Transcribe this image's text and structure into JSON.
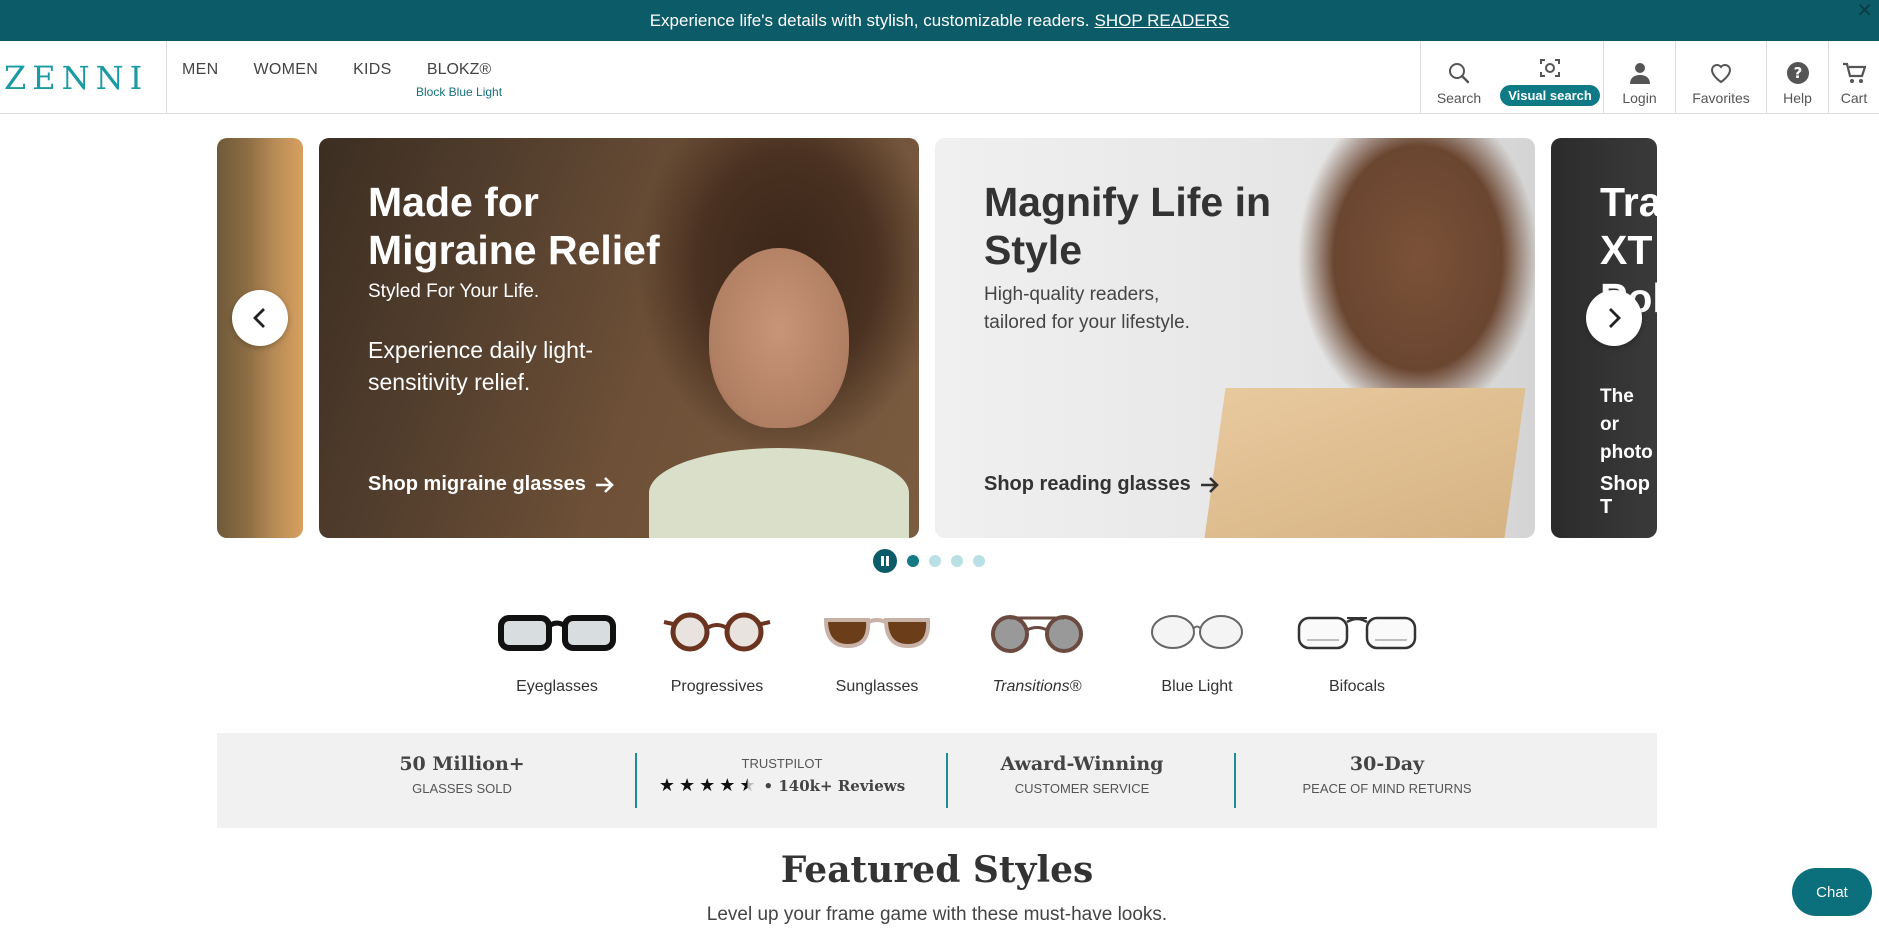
{
  "promo": {
    "text": "Experience life's details with stylish, customizable readers.",
    "link": "SHOP READERS",
    "close": "✕"
  },
  "header": {
    "logo": "ZENNI",
    "nav": [
      "MEN",
      "WOMEN",
      "KIDS"
    ],
    "blokz": {
      "label": "BLOKZ®",
      "sub": "Block Blue Light"
    },
    "utilities": {
      "search": "Search",
      "visual_search": "Visual search",
      "login": "Login",
      "favorites": "Favorites",
      "help": "Help",
      "cart": "Cart"
    }
  },
  "carousel": {
    "slides": [
      {
        "title": "Made for Migraine Relief",
        "sub1": "Styled For Your Life.",
        "sub2": "Experience daily light-sensitivity relief.",
        "cta": "Shop migraine glasses"
      },
      {
        "title": "Magnify Life in Style",
        "sub1": "High-quality readers, tailored for your lifestyle.",
        "cta": "Shop reading glasses"
      }
    ],
    "peek_right": {
      "title": "Tra XT Pol",
      "desc": "The or photo",
      "cta": "Shop T"
    },
    "dots": 4,
    "active_dot": 0
  },
  "categories": [
    {
      "label": "Eyeglasses",
      "icon": "eyeglasses-icon"
    },
    {
      "label": "Progressives",
      "icon": "progressives-icon"
    },
    {
      "label": "Sunglasses",
      "icon": "sunglasses-icon"
    },
    {
      "label": "Transitions®",
      "icon": "transitions-icon"
    },
    {
      "label": "Blue Light",
      "icon": "blue-light-icon"
    },
    {
      "label": "Bifocals",
      "icon": "bifocals-icon"
    }
  ],
  "trust": {
    "sold": {
      "big": "50 Million+",
      "small": "GLASSES SOLD"
    },
    "trustpilot": {
      "label": "TRUSTPILOT",
      "stars": 4.5,
      "reviews": "• 140k+ Reviews"
    },
    "service": {
      "big": "Award-Winning",
      "small": "CUSTOMER SERVICE"
    },
    "returns": {
      "big": "30-Day",
      "small": "PEACE OF MIND RETURNS"
    }
  },
  "featured": {
    "title": "Featured Styles",
    "subtitle": "Level up your frame game with these must-have looks."
  },
  "chat": "Chat",
  "colors": {
    "brand_teal": "#0c5b68",
    "accent_teal": "#157a86",
    "logo_teal": "#1a9aa3"
  }
}
